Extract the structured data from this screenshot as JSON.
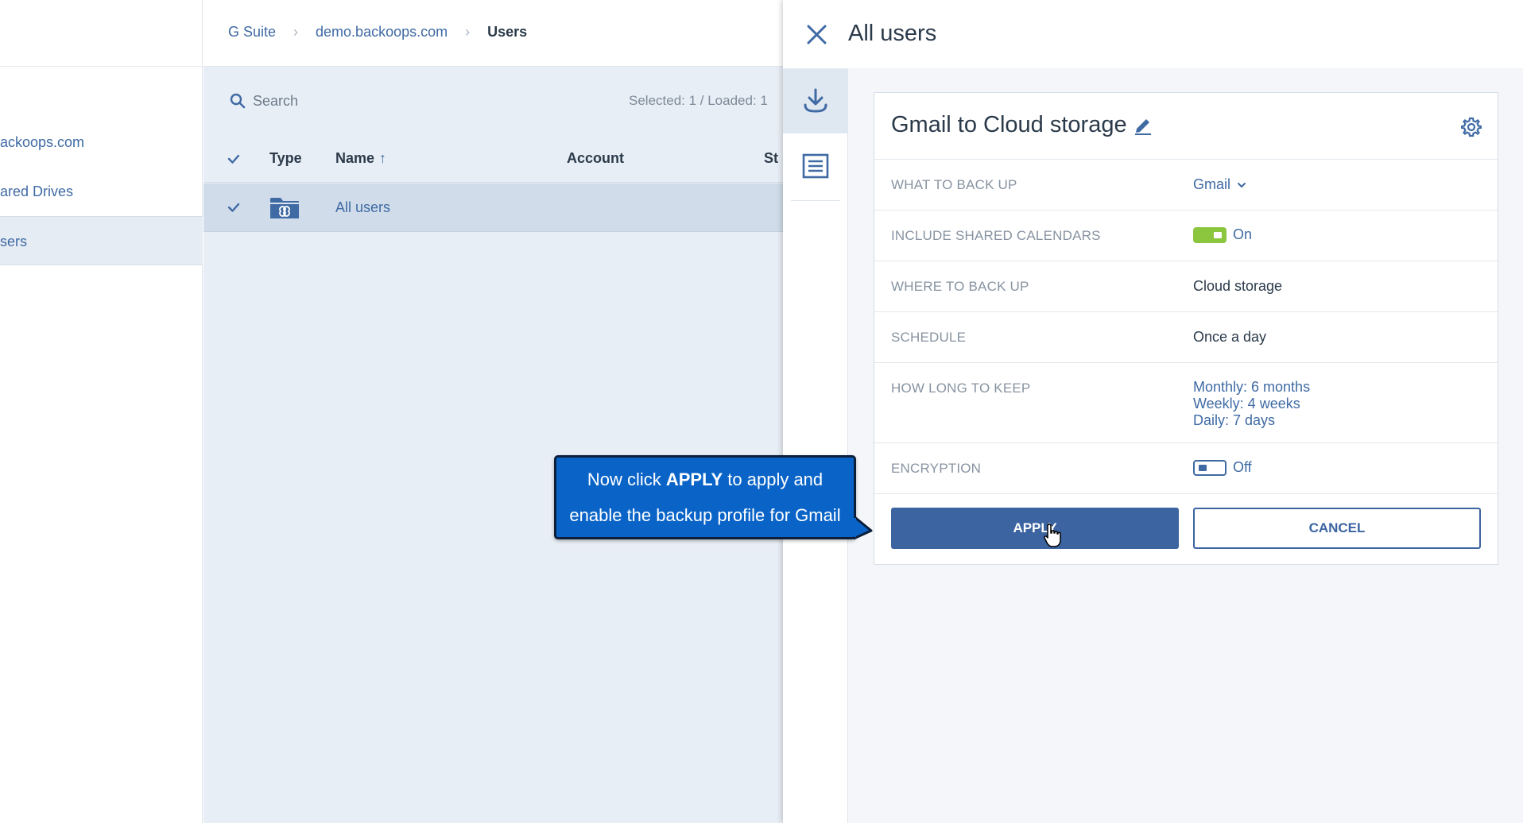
{
  "leftnav": {
    "items": [
      {
        "label": "ackoops.com"
      },
      {
        "label": "ared Drives"
      },
      {
        "label": "sers"
      }
    ]
  },
  "breadcrumb": {
    "items": [
      "G Suite",
      "demo.backoops.com"
    ],
    "current": "Users"
  },
  "search": {
    "placeholder": "Search",
    "selected_info": "Selected: 1 / Loaded: 1"
  },
  "table": {
    "columns": [
      "Type",
      "Name",
      "Account",
      "St"
    ],
    "rows": [
      {
        "name": "All users",
        "checked": true
      }
    ]
  },
  "panel": {
    "title": "All users",
    "card_title": "Gmail to Cloud storage",
    "rows": {
      "what_label": "WHAT TO BACK UP",
      "what_value": "Gmail",
      "calendars_label": "INCLUDE SHARED CALENDARS",
      "calendars_value": "On",
      "where_label": "WHERE TO BACK UP",
      "where_value": "Cloud storage",
      "schedule_label": "SCHEDULE",
      "schedule_value": "Once a day",
      "keep_label": "HOW LONG TO KEEP",
      "keep_monthly": "Monthly: 6 months",
      "keep_weekly": "Weekly: 4 weeks",
      "keep_daily": "Daily: 7 days",
      "encryption_label": "ENCRYPTION",
      "encryption_value": "Off"
    },
    "apply_label": "APPLY",
    "cancel_label": "CANCEL"
  },
  "callout": {
    "line1_pre": "Now click ",
    "line1_bold": "APPLY",
    "line1_post": " to apply and",
    "line2": "enable the backup profile for Gmail"
  },
  "colors": {
    "accent": "#3b64a0",
    "toggle_on": "#8cc63f",
    "callout_bg": "#0a64c8"
  }
}
